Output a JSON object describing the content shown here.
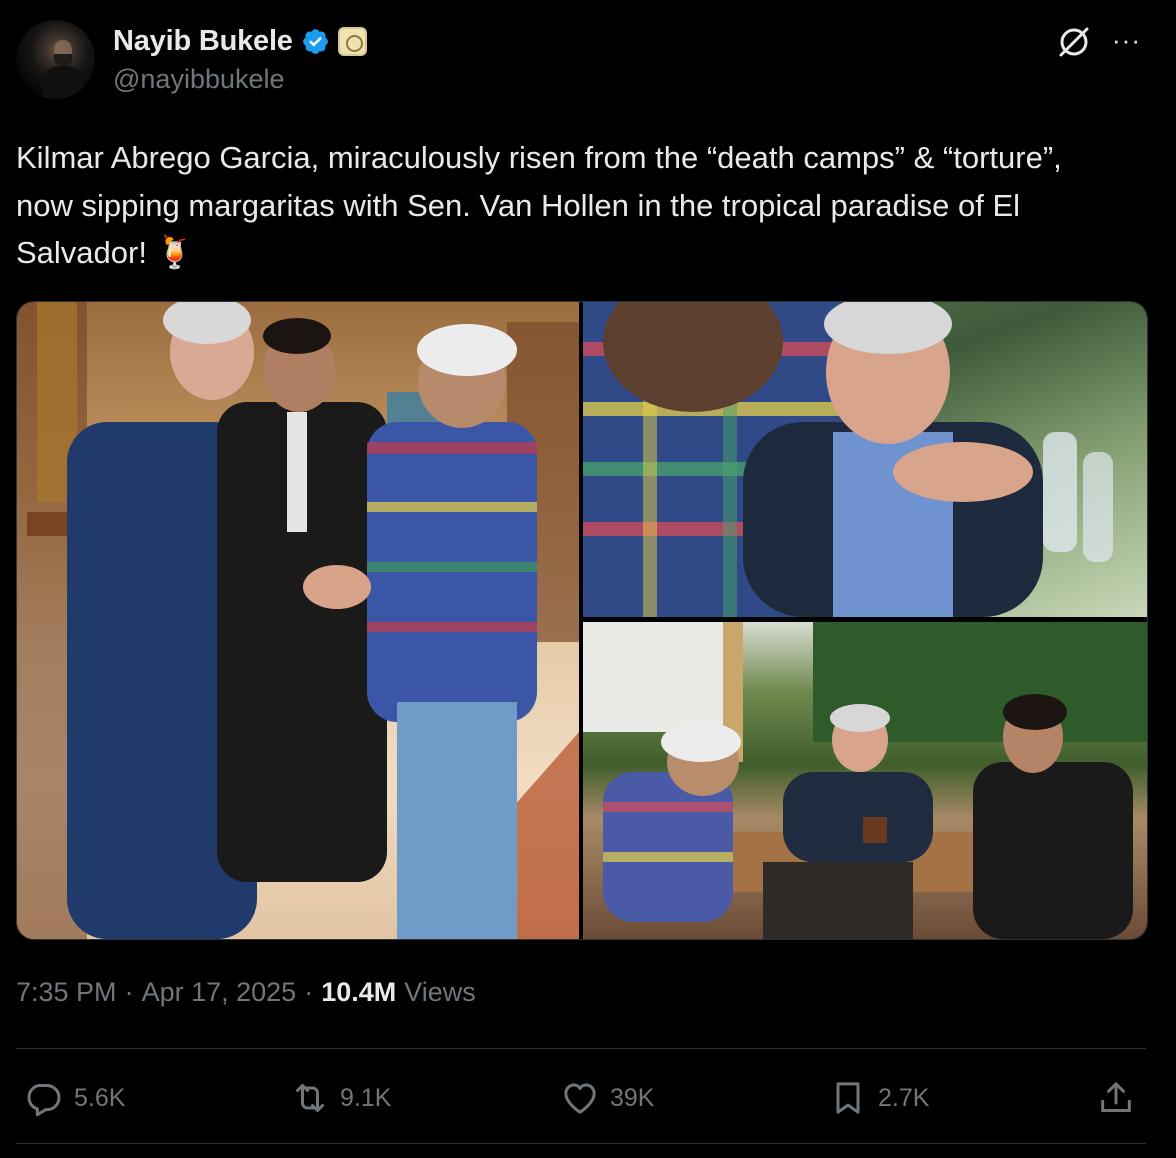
{
  "author": {
    "display_name": "Nayib Bukele",
    "handle": "@nayibbukele",
    "verified": true,
    "affiliate_badge": "government-seal-badge",
    "avatar": "profile-photo"
  },
  "tweet": {
    "text": "Kilmar Abrego Garcia, miraculously risen from the “death camps” & “torture”, now sipping margaritas with Sen. Van Hollen in the tropical paradise of El Salvador! 🍹",
    "photo_count": 3
  },
  "meta": {
    "time": "7:35 PM",
    "separator": "·",
    "date": "Apr 17, 2025",
    "views_count": "10.4M",
    "views_label": "Views"
  },
  "actions": {
    "replies": "5.6K",
    "reposts": "9.1K",
    "likes": "39K",
    "bookmarks": "2.7K"
  },
  "icons": {
    "grok": "grok-icon",
    "more": "more-icon",
    "reply": "reply-icon",
    "repost": "repost-icon",
    "like": "heart-icon",
    "bookmark": "bookmark-icon",
    "share": "share-icon"
  },
  "colors": {
    "background": "#000000",
    "text_primary": "#e7e9ea",
    "text_secondary": "#71767b",
    "verified_blue": "#1d9bf0",
    "border": "#2f3336"
  }
}
